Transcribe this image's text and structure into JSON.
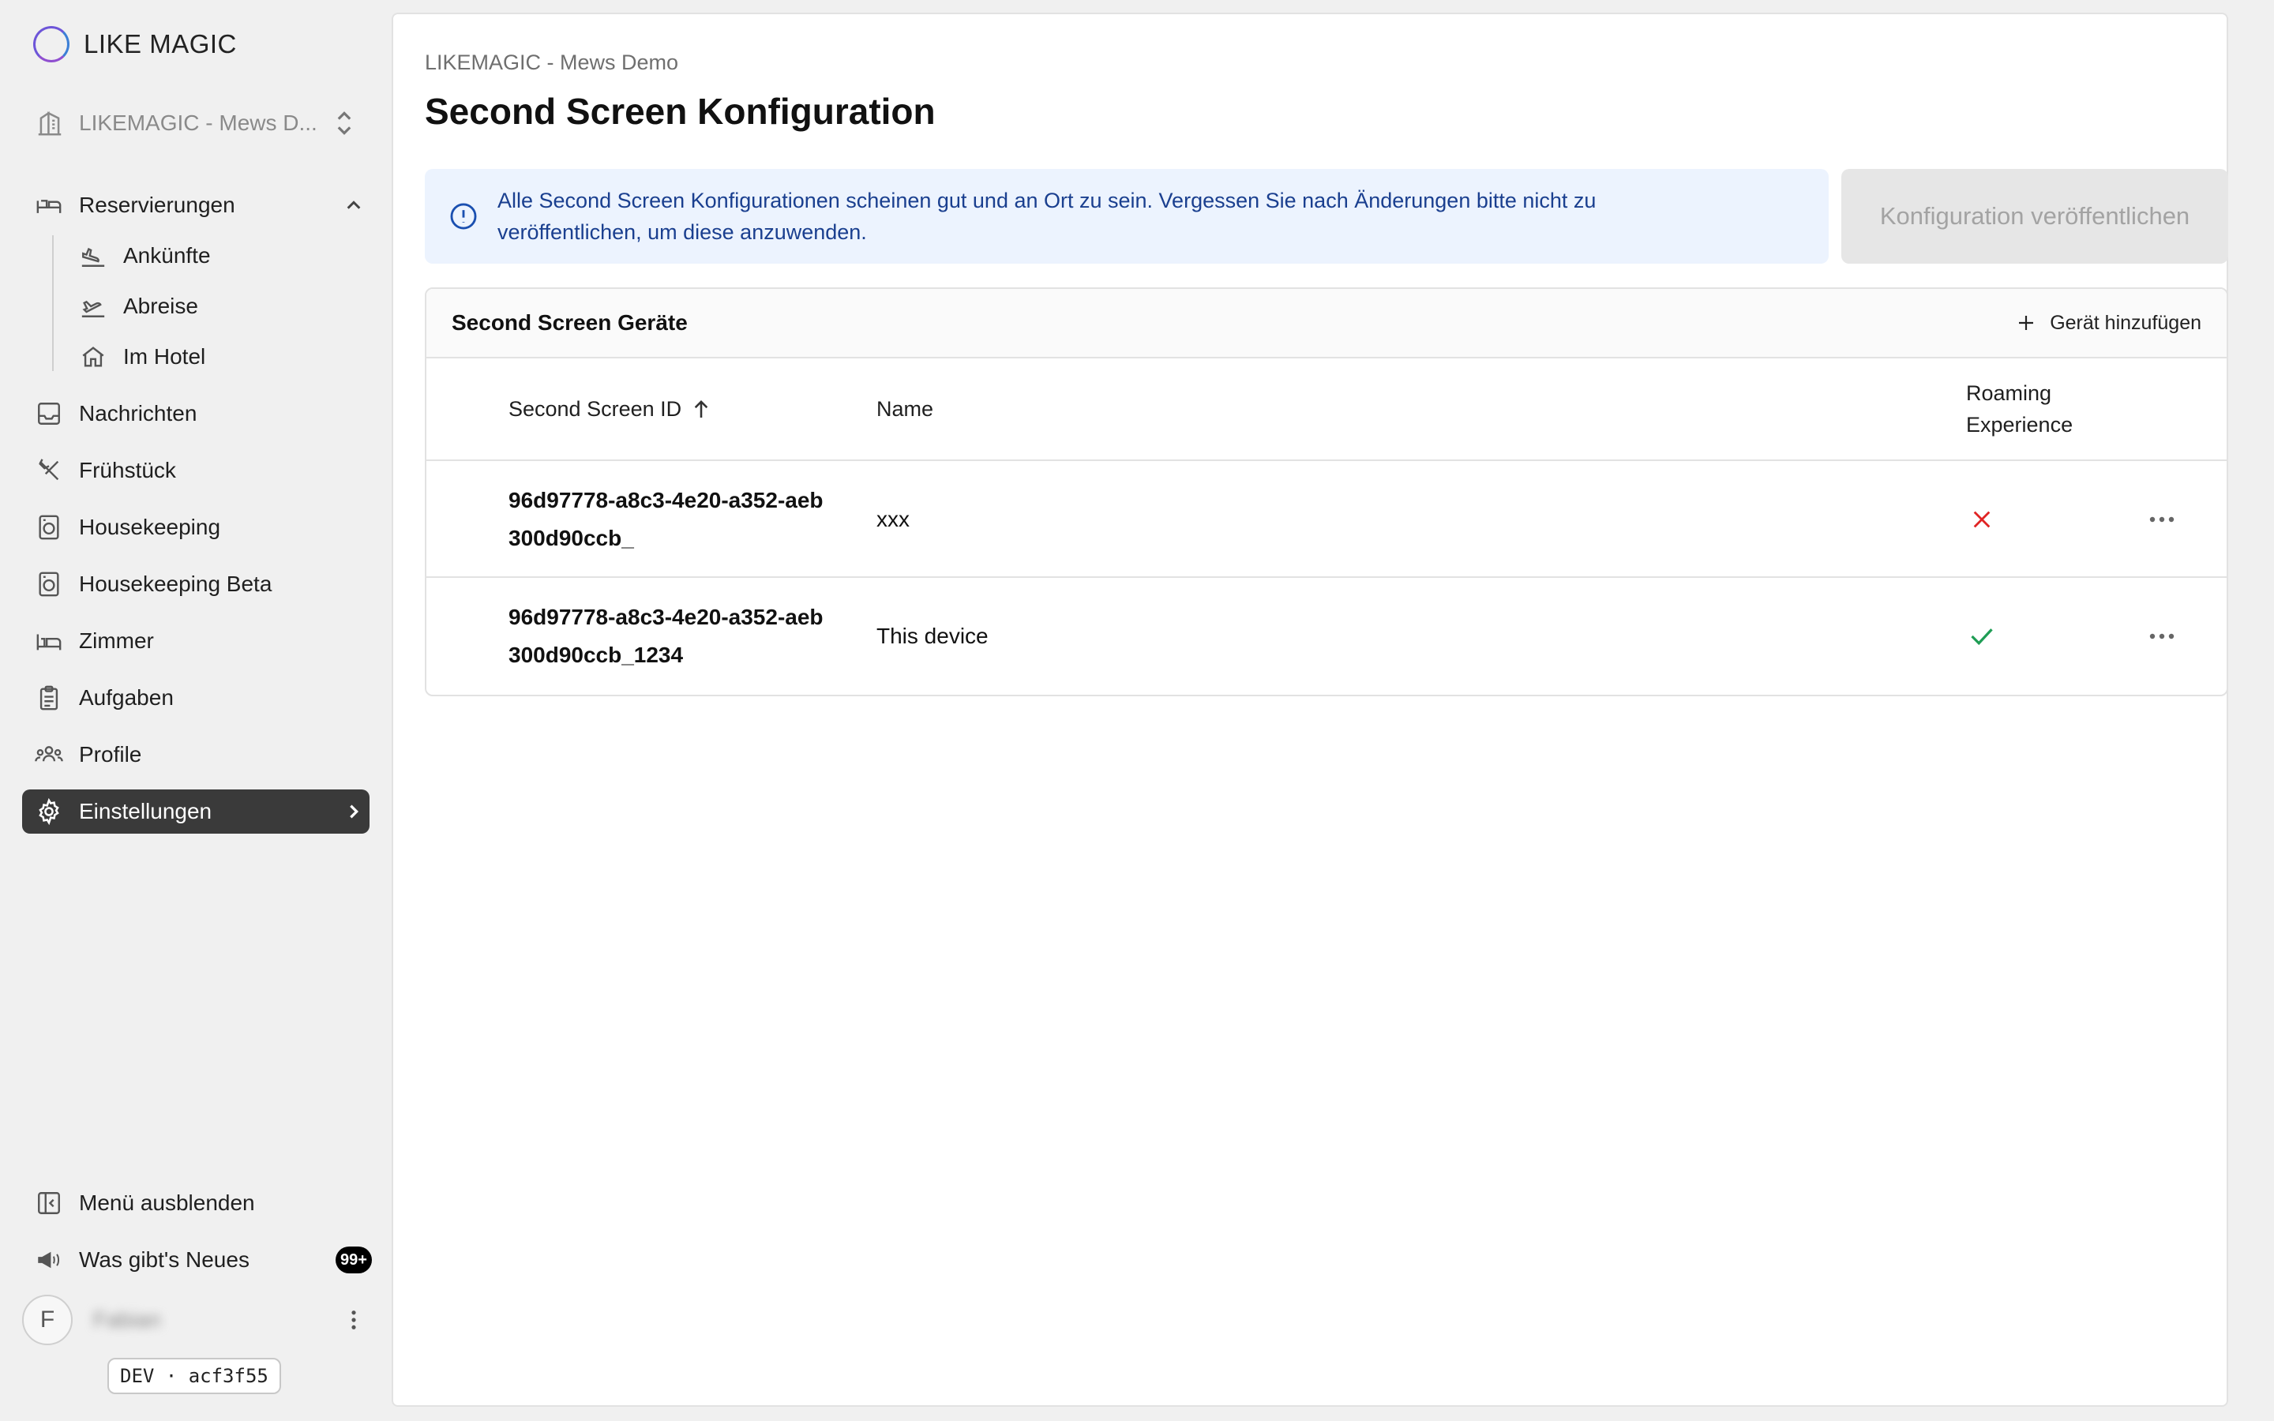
{
  "brand": {
    "name": "LIKE MAGIC"
  },
  "property": {
    "label": "LIKEMAGIC - Mews D..."
  },
  "nav": {
    "reservations": "Reservierungen",
    "arrivals": "Ankünfte",
    "departures": "Abreise",
    "in_hotel": "Im Hotel",
    "messages": "Nachrichten",
    "breakfast": "Frühstück",
    "housekeeping": "Housekeeping",
    "housekeeping_beta": "Housekeeping Beta",
    "rooms": "Zimmer",
    "tasks": "Aufgaben",
    "profiles": "Profile",
    "settings": "Einstellungen"
  },
  "footer": {
    "hide_menu": "Menü ausblenden",
    "whats_new": "Was gibt's Neues",
    "whats_new_badge": "99+",
    "avatar_initial": "F",
    "user_name": "Fabian",
    "env_tag": "DEV · acf3f55"
  },
  "page": {
    "breadcrumb": "LIKEMAGIC - Mews Demo",
    "title": "Second Screen Konfiguration",
    "banner_text": "Alle Second Screen Konfigurationen scheinen gut und an Ort zu sein. Vergessen Sie nach Änderungen bitte nicht zu veröffentlichen, um diese anzuwenden.",
    "publish_label": "Konfiguration veröffentlichen"
  },
  "devices": {
    "title": "Second Screen Geräte",
    "add_label": "Gerät hinzufügen",
    "columns": {
      "id": "Second Screen ID",
      "name": "Name",
      "roaming_line1": "Roaming",
      "roaming_line2": "Experience"
    },
    "rows": [
      {
        "id": "96d97778-a8c3-4e20-a352-aeb300d90ccb_",
        "name": "xxx",
        "roaming": "disabled"
      },
      {
        "id": "96d97778-a8c3-4e20-a352-aeb300d90ccb_1234",
        "name": "This device",
        "roaming": "enabled"
      }
    ]
  },
  "colors": {
    "active_nav": "#3a3a3a",
    "banner_bg": "#ecf3fe",
    "banner_text": "#1a3f8f",
    "error_red": "#e02424",
    "success_green": "#1f9d55"
  }
}
